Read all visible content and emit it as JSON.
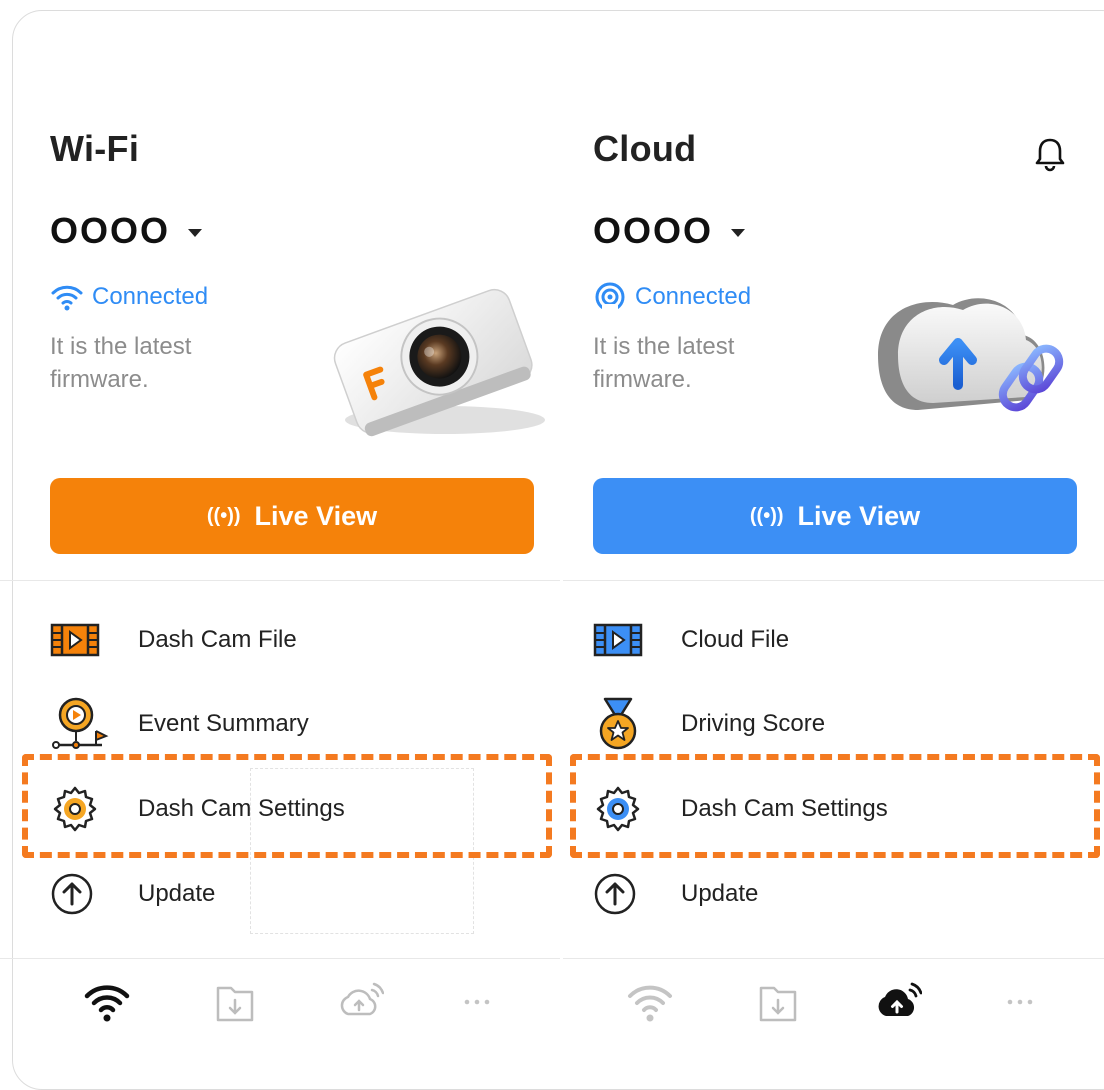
{
  "wifi": {
    "title": "Wi-Fi",
    "device": "OOOO",
    "status": "Connected",
    "firmware": "It is the latest firmware.",
    "live_view": "Live View",
    "menu": [
      "Dash Cam File",
      "Event Summary",
      "Dash Cam Settings",
      "Update"
    ]
  },
  "cloud": {
    "title": "Cloud",
    "device": "OOOO",
    "status": "Connected",
    "firmware": "It is the latest firmware.",
    "live_view": "Live View",
    "menu": [
      "Cloud File",
      "Driving Score",
      "Dash Cam Settings",
      "Update"
    ]
  },
  "live_view_icon": "((•))",
  "colors": {
    "wifi_accent": "#f5820a",
    "cloud_accent": "#3c8ff5",
    "status_blue": "#2f8cf5",
    "highlight_dash": "#f47a20"
  },
  "icons": {
    "wifi_status": "wifi-icon",
    "cloud_status": "cloud-signal-icon",
    "bell": "bell-icon",
    "tabs": [
      "wifi-tab-icon",
      "download-tab-icon",
      "cloud-upload-tab-icon",
      "more-tab-icon"
    ]
  },
  "active_tab": {
    "wifi": 0,
    "cloud": 2
  }
}
